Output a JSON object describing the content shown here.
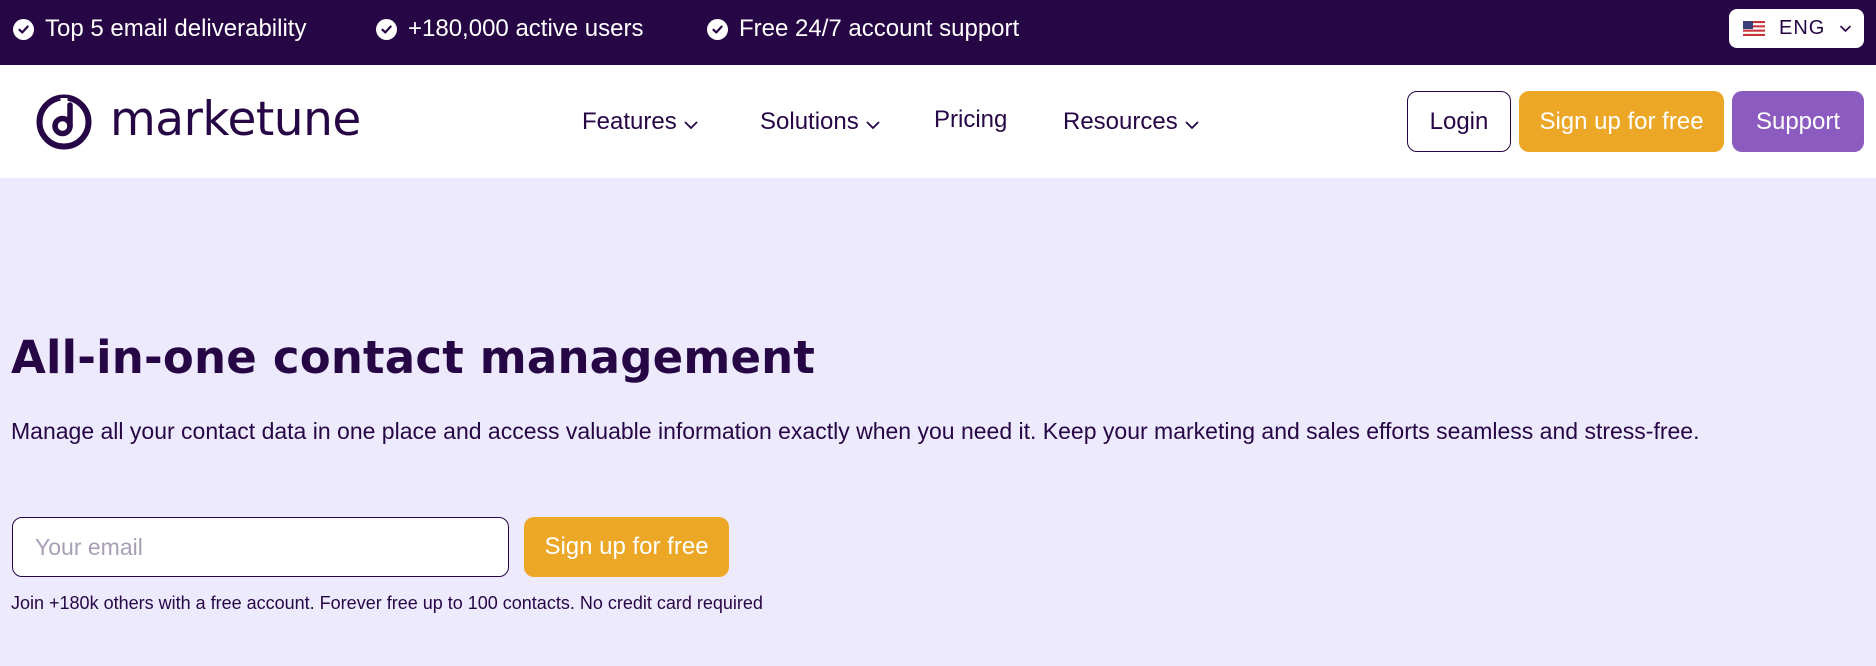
{
  "topbar": {
    "perks": [
      "Top 5 email deliverability",
      "+180,000 active users",
      "Free 24/7 account support"
    ],
    "language": "ENG"
  },
  "header": {
    "logo_text": "marketune",
    "nav": {
      "features": "Features",
      "solutions": "Solutions",
      "pricing": "Pricing",
      "resources": "Resources"
    },
    "login_label": "Login",
    "signup_label": "Sign up for free",
    "support_label": "Support"
  },
  "hero": {
    "title": "All-in-one contact management",
    "subtitle": "Manage all your contact data in one place and access valuable information exactly when you need it. Keep your marketing and sales efforts seamless and stress-free.",
    "email_placeholder": "Your email",
    "signup_label": "Sign up for free",
    "fineprint": "Join +180k others with a free account. Forever free up to 100 contacts. No credit card required"
  },
  "colors": {
    "brand_dark": "#270645",
    "accent_orange": "#eda726",
    "support_purple": "#8c5bbf",
    "hero_background": "#edeafd"
  },
  "icons": {
    "perk": "check-circle-icon",
    "flag": "us-flag-icon",
    "dropdown": "chevron-down-icon",
    "logo": "marketune-logo-icon"
  }
}
